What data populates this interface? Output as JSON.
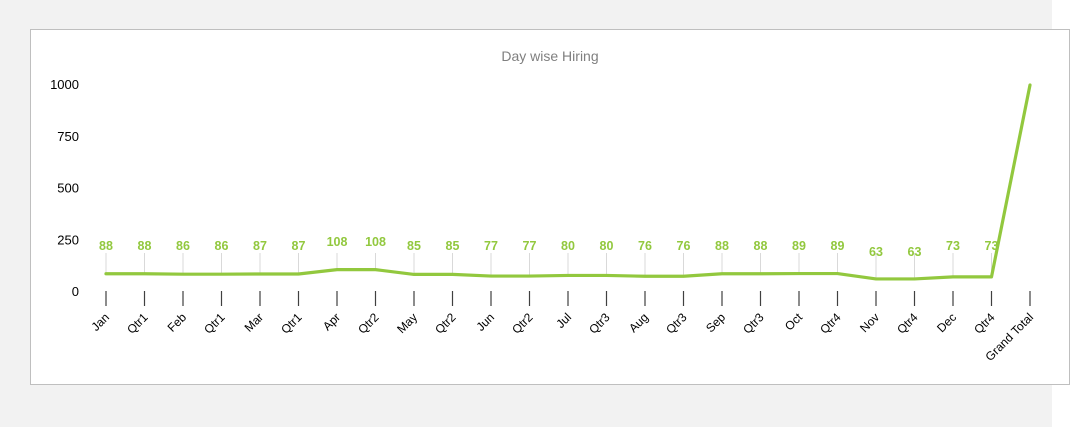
{
  "chart_data": {
    "type": "line",
    "title": "Day wise Hiring",
    "xlabel": "",
    "ylabel": "",
    "ylim": [
      0,
      1000
    ],
    "yticks": [
      0,
      250,
      500,
      750,
      1000
    ],
    "categories": [
      "Jan",
      "Qtr1",
      "Feb",
      "Qtr1",
      "Mar",
      "Qtr1",
      "Apr",
      "Qtr2",
      "May",
      "Qtr2",
      "Jun",
      "Qtr2",
      "Jul",
      "Qtr3",
      "Aug",
      "Qtr3",
      "Sep",
      "Qtr3",
      "Oct",
      "Qtr4",
      "Nov",
      "Qtr4",
      "Dec",
      "Qtr4",
      "Grand Total"
    ],
    "series": [
      {
        "values": [
          88,
          88,
          86,
          86,
          87,
          87,
          108,
          108,
          85,
          85,
          77,
          77,
          80,
          80,
          76,
          76,
          88,
          88,
          89,
          89,
          63,
          63,
          73,
          73,
          1000
        ],
        "labels": [
          "88",
          "88",
          "86",
          "86",
          "87",
          "87",
          "108",
          "108",
          "85",
          "85",
          "77",
          "77",
          "80",
          "80",
          "76",
          "76",
          "88",
          "88",
          "89",
          "89",
          "63",
          "63",
          "73",
          "73",
          ""
        ]
      }
    ],
    "grid": false,
    "legend": "none",
    "colors": {
      "line": "#92c83e",
      "label": "#92c83e",
      "axis": "#404040",
      "leader": "#d9d9d9"
    }
  }
}
